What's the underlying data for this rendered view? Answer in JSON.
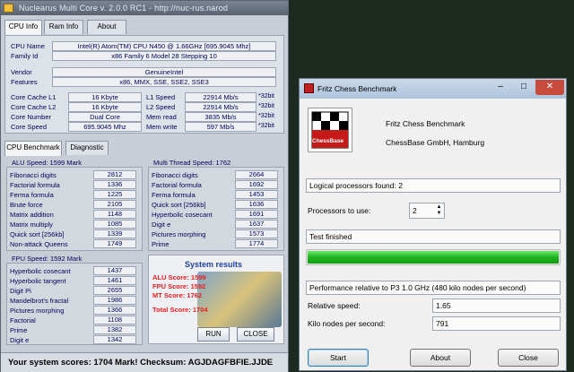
{
  "nucleus": {
    "title": "Nuclearus Multi Core  v. 2.0.0    RC1    -    http://nuc-rus.narod",
    "tabs": [
      "CPU Info",
      "Ram Info",
      "About"
    ],
    "cpu_info": {
      "cpu_name_label": "CPU Name",
      "cpu_name": "Intel(R) Atom(TM) CPU N450  @ 1.66GHz [695.9045 Mhz]",
      "family_label": "Family Id",
      "family": "x86 Family 6 Model 28 Stepping 10",
      "vendor_label": "Vendor",
      "vendor": "GenuineIntel",
      "features_label": "Features",
      "features": "x86, MMX, SSE, SSE2, SSE3",
      "core_cache_l1_label": "Core Cache L1",
      "core_cache_l1": "16 Kbyte",
      "core_cache_l2_label": "Core Cache L2",
      "core_cache_l2": "16 Kbyte",
      "core_number_label": "Core Number",
      "core_number": "Dual Core",
      "core_speed_label": "Core Speed",
      "core_speed": "695.9045 Mhz",
      "l1_speed_label": "L1 Speed",
      "l1_speed": "22914 Mb/s",
      "l2_speed_label": "L2 Speed",
      "l2_speed": "22914 Mb/s",
      "mem_read_label": "Mem read",
      "mem_read": "3835 Mb/s",
      "mem_write_label": "Mem write",
      "mem_write": "597 Mb/s",
      "bit_suffix": "*32bit"
    },
    "bench_tabs": [
      "CPU Benchmark",
      "Diagnostic"
    ],
    "alu": {
      "header": "ALU Speed: 1599 Mark",
      "rows": [
        {
          "name": "Fibonacci digits",
          "value": "2812"
        },
        {
          "name": "Factorial formula",
          "value": "1336"
        },
        {
          "name": "Ferma formula",
          "value": "1225"
        },
        {
          "name": "Brute force",
          "value": "2105"
        },
        {
          "name": "Matrix addition",
          "value": "1148"
        },
        {
          "name": "Matrix multiply",
          "value": "1085"
        },
        {
          "name": "Quick sort [256kb]",
          "value": "1339"
        },
        {
          "name": "Non-attack Queens",
          "value": "1749"
        }
      ]
    },
    "mt": {
      "header": "Multi Thread Speed: 1762",
      "rows": [
        {
          "name": "Fibonacci digits",
          "value": "2664"
        },
        {
          "name": "Factorial formula",
          "value": "1692"
        },
        {
          "name": "Ferma formula",
          "value": "1453"
        },
        {
          "name": "Quick sort [256kb]",
          "value": "1636"
        },
        {
          "name": "Hyperbolic cosecant",
          "value": "1691"
        },
        {
          "name": "Digit e",
          "value": "1637"
        },
        {
          "name": "Pictures morphing",
          "value": "1573"
        },
        {
          "name": "Prime",
          "value": "1774"
        }
      ]
    },
    "fpu": {
      "header": "FPU Speed: 1592 Mark",
      "rows": [
        {
          "name": "Hyperbolic cosecant",
          "value": "1437"
        },
        {
          "name": "Hyperbolic tangent",
          "value": "1461"
        },
        {
          "name": "Digit Pi",
          "value": "2655"
        },
        {
          "name": "Mandelbrot's fractal",
          "value": "1986"
        },
        {
          "name": "Pictures morphing",
          "value": "1366"
        },
        {
          "name": "Factorial",
          "value": "1108"
        },
        {
          "name": "Prime",
          "value": "1382"
        },
        {
          "name": "Digit e",
          "value": "1342"
        }
      ]
    },
    "results": {
      "title": "System results",
      "alu": "ALU Score: 1599",
      "fpu": "FPU Score: 1592",
      "mt": "MT Score: 1762",
      "total": "Total Score: 1704",
      "run": "RUN",
      "close": "CLOSE"
    },
    "status": "Your system scores: 1704 Mark!    Checksum: AGJDAGFBFIE.JJDE"
  },
  "fritz": {
    "title": "Fritz Chess Benchmark",
    "logo_text": "ChessBase",
    "app_name": "Fritz Chess Benchmark",
    "company": "ChessBase GmbH, Hamburg",
    "logical_processors": "Logical processors found: 2",
    "processors_label": "Processors to use:",
    "processors_value": "2",
    "status": "Test finished",
    "progress": 1.0,
    "performance": "Performance relative to P3 1.0 GHz (480 kilo nodes per second)",
    "relative_label": "Relative speed:",
    "relative_value": "1.65",
    "knps_label": "Kilo nodes per second:",
    "knps_value": "791",
    "buttons": {
      "start": "Start",
      "about": "About",
      "close": "Close"
    },
    "colors": {
      "progress": "#22c222"
    }
  }
}
